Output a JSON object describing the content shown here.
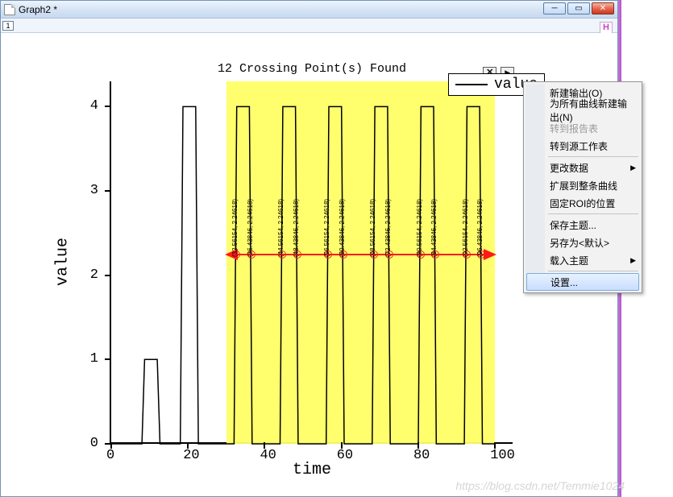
{
  "window": {
    "title": "Graph2 *"
  },
  "toolbar": {
    "frame": "1"
  },
  "chart_data": {
    "type": "line",
    "title": "12 Crossing Point(s) Found",
    "xlabel": "time",
    "ylabel": "value",
    "xlim": [
      0,
      105
    ],
    "ylim": [
      0,
      4.3
    ],
    "xticks": [
      0,
      20,
      40,
      60,
      80,
      100
    ],
    "yticks": [
      0,
      1,
      2,
      3,
      4
    ],
    "legend": {
      "name": "value"
    },
    "series": [
      {
        "name": "value",
        "x": [
          0,
          8,
          8.7,
          12,
          12.7,
          13,
          18,
          18.7,
          22,
          22.7,
          23,
          32,
          32.7,
          36,
          36.7,
          37,
          44,
          44.7,
          48,
          48.7,
          49,
          56,
          56.7,
          60,
          60.7,
          61,
          68,
          68.7,
          72,
          72.7,
          73,
          80,
          80.7,
          84,
          84.7,
          85,
          92,
          92.7,
          96,
          96.7,
          100
        ],
        "y": [
          0,
          0,
          1,
          1,
          0,
          0,
          0,
          4,
          4,
          0,
          0,
          0,
          4,
          4,
          0,
          0,
          0,
          4,
          4,
          0,
          0,
          0,
          4,
          4,
          0,
          0,
          0,
          4,
          4,
          0,
          0,
          0,
          4,
          4,
          0,
          0,
          0,
          4,
          4,
          0,
          0
        ]
      }
    ],
    "roi": {
      "x0": 30,
      "x1": 100
    },
    "crossing_y": 2.24618,
    "crossing_points": [
      {
        "x": 32.56154,
        "y": 2.24618
      },
      {
        "x": 36.43846,
        "y": 2.24618
      },
      {
        "x": 44.56154,
        "y": 2.24618
      },
      {
        "x": 48.43846,
        "y": 2.24618
      },
      {
        "x": 56.56154,
        "y": 2.24618
      },
      {
        "x": 60.43846,
        "y": 2.24618
      },
      {
        "x": 68.56154,
        "y": 2.24618
      },
      {
        "x": 72.43846,
        "y": 2.24618
      },
      {
        "x": 80.56154,
        "y": 2.24618
      },
      {
        "x": 84.43846,
        "y": 2.24618
      },
      {
        "x": 92.56154,
        "y": 2.24618
      },
      {
        "x": 96.43846,
        "y": 2.24618
      }
    ]
  },
  "context_menu": {
    "items": [
      {
        "label": "新建输出(O)",
        "enabled": true
      },
      {
        "label": "为所有曲线新建输出(N)",
        "enabled": true
      },
      {
        "label": "转到报告表",
        "enabled": false
      },
      {
        "label": "转到源工作表",
        "enabled": true
      },
      {
        "sep": true
      },
      {
        "label": "更改数据",
        "enabled": true,
        "submenu": true
      },
      {
        "label": "扩展到整条曲线",
        "enabled": true
      },
      {
        "label": "固定ROI的位置",
        "enabled": true
      },
      {
        "sep": true
      },
      {
        "label": "保存主题...",
        "enabled": true
      },
      {
        "label": "另存为<默认>",
        "enabled": true
      },
      {
        "label": "载入主题",
        "enabled": true,
        "submenu": true
      },
      {
        "sep": true
      },
      {
        "label": "设置...",
        "enabled": true,
        "selected": true
      }
    ]
  },
  "watermark": "https://blog.csdn.net/Temmie1024"
}
